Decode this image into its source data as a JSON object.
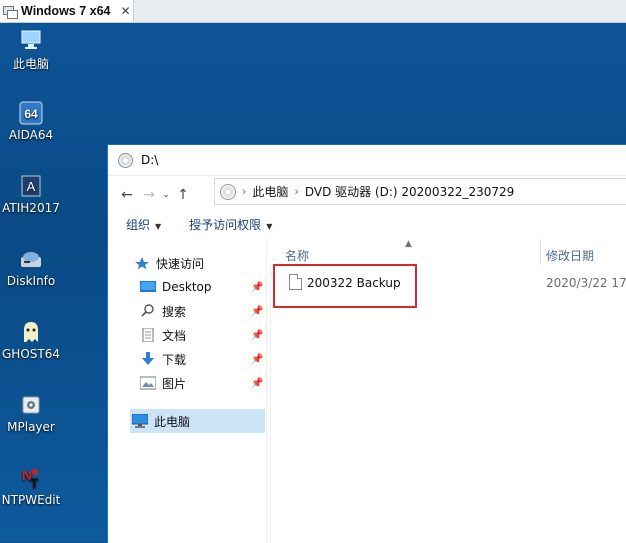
{
  "vm_tab": {
    "title": "Windows 7 x64",
    "close": "✕"
  },
  "desktop_icons": [
    {
      "label": "此电脑",
      "icon": "computer-icon"
    },
    {
      "label": "AIDA64",
      "icon": "aida64-icon"
    },
    {
      "label": "ATIH2017",
      "icon": "atih-icon"
    },
    {
      "label": "DiskInfo",
      "icon": "diskinfo-icon"
    },
    {
      "label": "GHOST64",
      "icon": "ghost-icon"
    },
    {
      "label": "MPlayer",
      "icon": "mplayer-icon"
    },
    {
      "label": "NTPWEdit",
      "icon": "ntpwedit-icon"
    }
  ],
  "window": {
    "title": "D:\\",
    "address": {
      "parts": [
        "此电脑",
        "DVD 驱动器 (D:) 20200322_230729"
      ]
    },
    "commands": {
      "organize": "组织",
      "grant_access": "授予访问权限"
    },
    "nav": {
      "quick_access": "快速访问",
      "items": [
        {
          "label": "Desktop",
          "icon": "desktop-icon"
        },
        {
          "label": "搜索",
          "icon": "search-icon"
        },
        {
          "label": "文档",
          "icon": "document-icon"
        },
        {
          "label": "下载",
          "icon": "download-icon"
        },
        {
          "label": "图片",
          "icon": "picture-icon"
        }
      ],
      "this_pc": "此电脑"
    },
    "columns": {
      "name": "名称",
      "modified": "修改日期"
    },
    "files": [
      {
        "name": "200322 Backup",
        "modified": "2020/3/22 17:"
      }
    ]
  },
  "colors": {
    "highlight": "#d42a2a",
    "selection": "#cce4f7",
    "desktop": "#0b4e8e"
  }
}
